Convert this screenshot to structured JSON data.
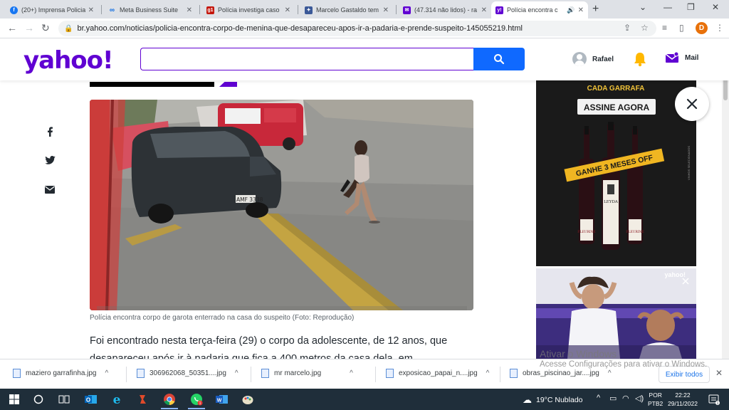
{
  "tabs": [
    {
      "title": "(20+) Imprensa Policia",
      "icon": "facebook-icon",
      "color": "#1877f2"
    },
    {
      "title": "Meta Business Suite",
      "icon": "meta-icon",
      "color": "#0668e1"
    },
    {
      "title": "Polícia investiga caso",
      "icon": "g1-icon",
      "color": "#c4170c",
      "badge": "g1"
    },
    {
      "title": "Marcelo Gastaldo tem",
      "icon": "site-icon",
      "color": "#3b5998"
    },
    {
      "title": "(47.314 não lidos) - ra",
      "icon": "yahoo-mail-icon",
      "color": "#6001d2"
    },
    {
      "title": "Polícia encontra c",
      "icon": "yahoo-icon",
      "color": "#6001d2",
      "badge": "y!"
    }
  ],
  "address": {
    "url": "br.yahoo.com/noticias/policia-encontra-corpo-de-menina-que-desapareceu-apos-ir-a-padaria-e-prende-suspeito-145055219.html",
    "profile_initial": "D"
  },
  "header": {
    "logo": "yahoo!",
    "search_placeholder": "",
    "user_name": "Rafael",
    "mail_label": "Mail"
  },
  "article": {
    "caption": "Polícia encontra corpo de garota enterrado na casa do suspeito (Foto: Reprodução)",
    "paragraph": "Foi encontrado nesta terça-feira (29) o corpo da adolescente, de 12 anos, que desapareceu após ir à padaria que fica a 400 metros da casa dela, em Aparecida de",
    "photo_plate": "AMF 3338"
  },
  "ads": {
    "ad1_top": "CADA GARRAFA",
    "ad1_cta": "ASSINE AGORA",
    "ad1_promo": "GANHE 3 MESES OFF",
    "ad1_brand": "LEYDA",
    "ad1_wine": "FLEURINE",
    "ad2_badge": "yahoo!"
  },
  "watermark": {
    "line1": "Ativar o Windows",
    "line2": "Acesse Configurações para ativar o Windows."
  },
  "downloads": [
    {
      "name": "maziero garrafinha.jpg"
    },
    {
      "name": "306962068_50351....jpg"
    },
    {
      "name": "mr marcelo.jpg"
    },
    {
      "name": "exposicao_papai_n....jpg"
    },
    {
      "name": "obras_piscinao_jar....jpg"
    }
  ],
  "downloads_show_all": "Exibir todos",
  "taskbar": {
    "weather": "19°C  Nublado",
    "lang1": "POR",
    "lang2": "PTB2",
    "time": "22:22",
    "date": "29/11/2022",
    "notif_count": "1"
  }
}
